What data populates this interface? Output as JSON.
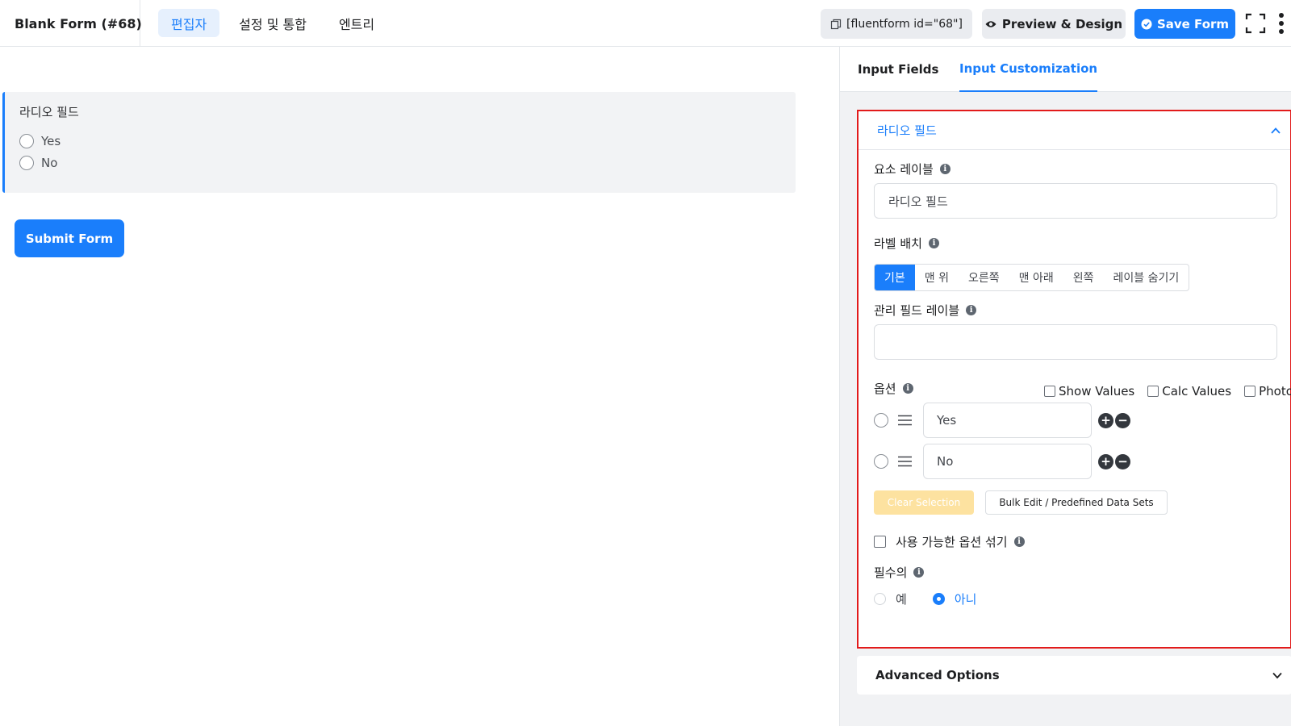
{
  "header": {
    "form_title": "Blank Form (#68)",
    "tabs": [
      {
        "label": "편집자",
        "active": true
      },
      {
        "label": "설정 및 통합",
        "active": false
      },
      {
        "label": "엔트리",
        "active": false
      }
    ],
    "shortcode": "[fluentform id=\"68\"]",
    "preview_label": "Preview & Design",
    "save_label": "Save Form",
    "icons": {
      "title": "pencil-icon",
      "shortcode": "copy-icon",
      "preview": "eye-icon",
      "save": "check-circle-icon",
      "fullscreen": "fullscreen-icon",
      "more": "more-vertical-icon"
    }
  },
  "canvas": {
    "field_label": "라디오 필드",
    "options": [
      "Yes",
      "No"
    ],
    "submit_label": "Submit Form"
  },
  "panel": {
    "tabs": [
      {
        "label": "Input Fields",
        "active": false
      },
      {
        "label": "Input Customization",
        "active": true
      }
    ],
    "section_title": "라디오 필드",
    "element_label": {
      "label": "요소 레이블",
      "value": "라디오 필드"
    },
    "label_placement": {
      "label": "라벨 배치",
      "options": [
        "기본",
        "맨 위",
        "오른쪽",
        "맨 아래",
        "왼쪽",
        "레이블 숨기기"
      ],
      "selected": "기본"
    },
    "admin_label": {
      "label": "관리 필드 레이블",
      "value": ""
    },
    "options_section": {
      "label": "옵션",
      "checks": [
        "Show Values",
        "Calc Values",
        "Photo"
      ],
      "items": [
        "Yes",
        "No"
      ]
    },
    "clear_selection_label": "Clear Selection",
    "bulk_edit_label": "Bulk Edit / Predefined Data Sets",
    "shuffle_label": "사용 가능한 옵션 섞기",
    "required": {
      "label": "필수의",
      "yes_label": "예",
      "no_label": "아니",
      "selected": "아니"
    },
    "advanced_label": "Advanced Options"
  },
  "colors": {
    "accent": "#1a7efb",
    "highlight_border": "#e21b1b",
    "clear_button": "#fde2a0"
  }
}
